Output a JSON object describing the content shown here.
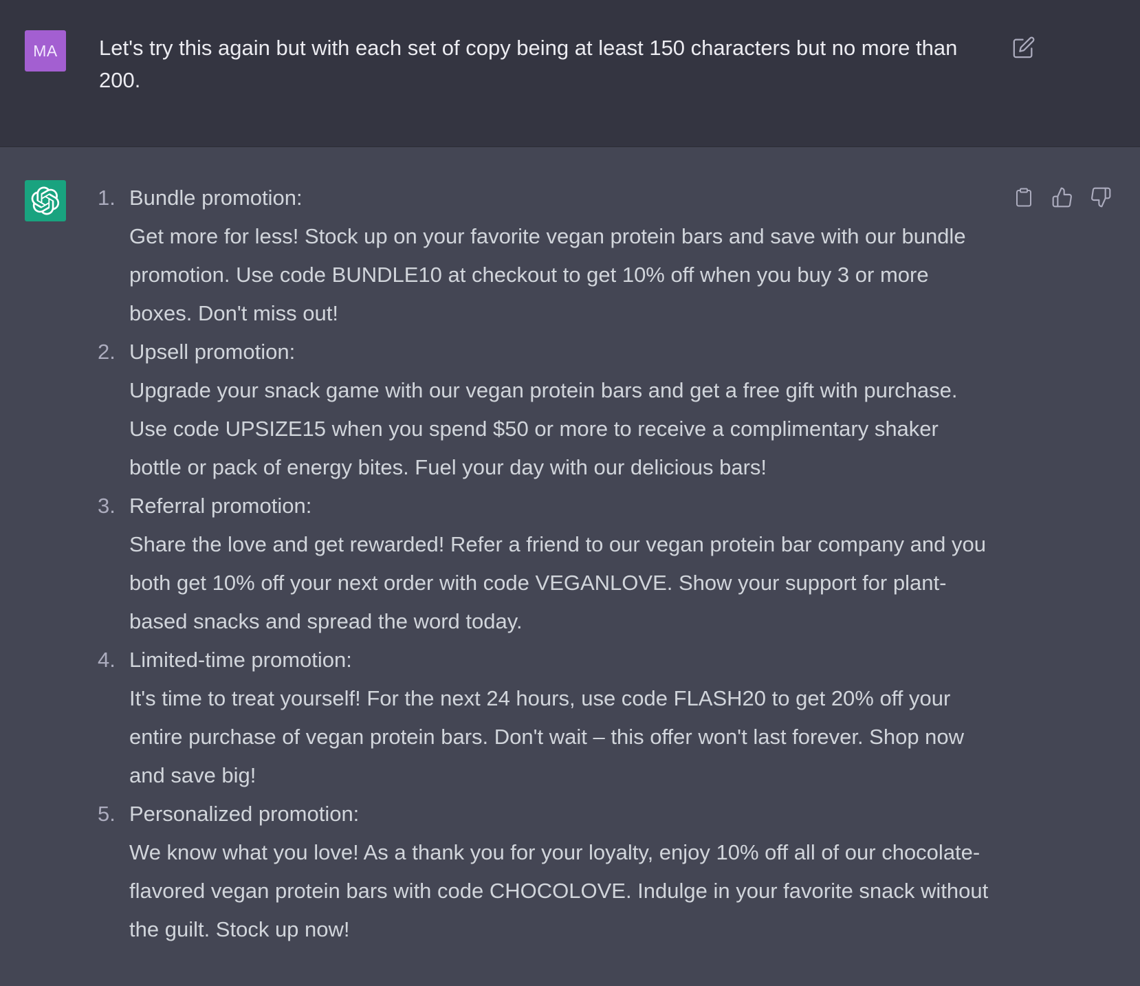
{
  "user": {
    "avatar_initials": "MA",
    "avatar_color": "#a35fd1",
    "message": "Let's try this again but with each set of copy being at least 150 characters but no more than 200."
  },
  "assistant": {
    "avatar_color": "#19a37f",
    "items": [
      {
        "number": "1.",
        "title": "Bundle promotion:",
        "text": "Get more for less! Stock up on your favorite vegan protein bars and save with our bundle promotion. Use code BUNDLE10 at checkout to get 10% off when you buy 3 or more boxes. Don't miss out!"
      },
      {
        "number": "2.",
        "title": "Upsell promotion:",
        "text": "Upgrade your snack game with our vegan protein bars and get a free gift with purchase. Use code UPSIZE15 when you spend $50 or more to receive a complimentary shaker bottle or pack of energy bites. Fuel your day with our delicious bars!"
      },
      {
        "number": "3.",
        "title": "Referral promotion:",
        "text": "Share the love and get rewarded! Refer a friend to our vegan protein bar company and you both get 10% off your next order with code VEGANLOVE. Show your support for plant-based snacks and spread the word today."
      },
      {
        "number": "4.",
        "title": "Limited-time promotion:",
        "text": "It's time to treat yourself! For the next 24 hours, use code FLASH20 to get 20% off your entire purchase of vegan protein bars. Don't wait – this offer won't last forever. Shop now and save big!"
      },
      {
        "number": "5.",
        "title": "Personalized promotion:",
        "text": "We know what you love! As a thank you for your loyalty, enjoy 10% off all of our chocolate-flavored vegan protein bars with code CHOCOLOVE. Indulge in your favorite snack without the guilt. Stock up now!"
      }
    ]
  },
  "icons": {
    "edit": "edit-icon",
    "copy": "clipboard-icon",
    "thumbs_up": "thumbs-up-icon",
    "thumbs_down": "thumbs-down-icon",
    "assistant_logo": "openai-logo-icon"
  }
}
